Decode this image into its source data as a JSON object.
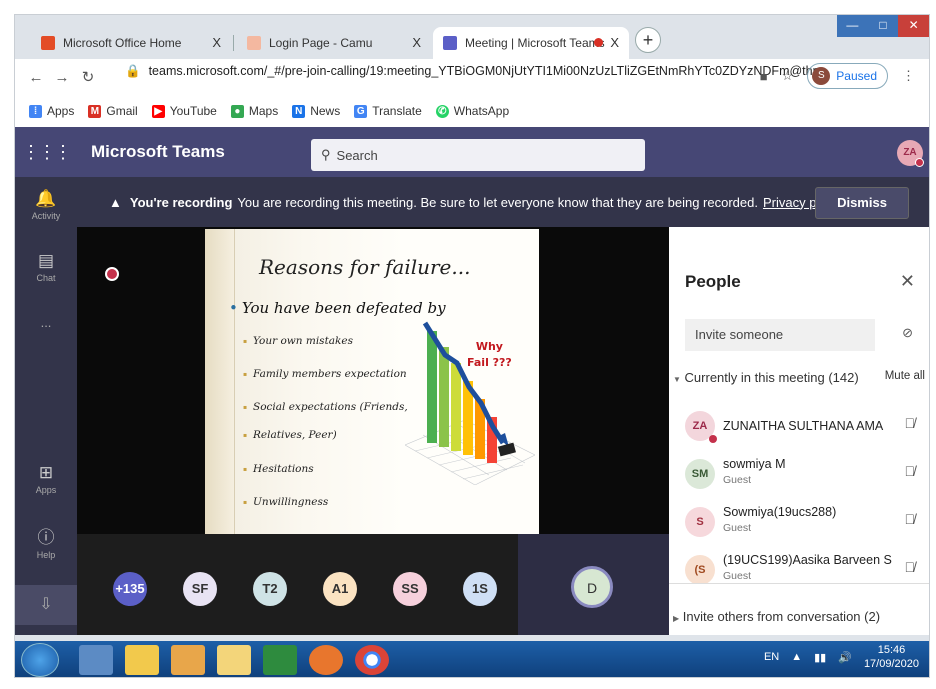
{
  "browser": {
    "tabs": [
      {
        "label": "Microsoft Office Home",
        "close": "X"
      },
      {
        "label": "Login Page - Camu",
        "close": "X"
      },
      {
        "label": "Meeting | Microsoft Teams",
        "close": "X"
      }
    ],
    "new_tab": "+",
    "url": "teams.microsoft.com/_#/pre-join-calling/19:meeting_YTBiOGM0NjUtYTI1Mi00NzUzLTliZGEtNmRhYTc0ZDYzNDFm@thr...",
    "profile_initial": "S",
    "paused_label": "Paused",
    "bookmarks": [
      {
        "label": "Apps",
        "color": "#4285f4"
      },
      {
        "label": "Gmail",
        "color": "#d93025"
      },
      {
        "label": "YouTube",
        "color": "#ff0000"
      },
      {
        "label": "Maps",
        "color": "#34a853"
      },
      {
        "label": "News",
        "color": "#1a73e8"
      },
      {
        "label": "Translate",
        "color": "#4285f4"
      },
      {
        "label": "WhatsApp",
        "color": "#25d366"
      }
    ]
  },
  "teams": {
    "app_title": "Microsoft Teams",
    "search_placeholder": "Search",
    "user_initials": "ZA",
    "rail": [
      {
        "label": "Activity",
        "icon": "bell-icon"
      },
      {
        "label": "Chat",
        "icon": "chat-icon"
      },
      {
        "label": "...",
        "icon": "more-icon"
      },
      {
        "label": "Apps",
        "icon": "apps-icon"
      },
      {
        "label": "Help",
        "icon": "help-icon"
      }
    ],
    "recording_bar": {
      "bold": "You're recording",
      "text": "You are recording this meeting. Be sure to let everyone know that they are being recorded.",
      "link": "Privacy policy",
      "dismiss": "Dismiss"
    },
    "slide": {
      "title": "Reasons for failure...",
      "subtitle": "You have been defeated by",
      "bullets": [
        "Your own mistakes",
        "Family members expectation",
        "Social expectations (Friends,",
        "Relatives, Peer)",
        "Hesitations",
        "Unwillingness"
      ],
      "why_line1": "Why",
      "why_line2": "Fail ???"
    },
    "tiles": [
      {
        "label": "+135",
        "bg": "#5b5fc7",
        "fg": "#ffffff"
      },
      {
        "label": "SF",
        "bg": "#e8e3f3",
        "fg": "#333333"
      },
      {
        "label": "T2",
        "bg": "#cfe3e6",
        "fg": "#333333"
      },
      {
        "label": "A1",
        "bg": "#fbe3c2",
        "fg": "#333333"
      },
      {
        "label": "SS",
        "bg": "#f6d0dc",
        "fg": "#333333"
      },
      {
        "label": "1S",
        "bg": "#cfdff5",
        "fg": "#333333"
      }
    ],
    "active_speaker": "D",
    "people": {
      "title": "People",
      "close": "X",
      "invite_placeholder": "Invite someone",
      "current_label": "Currently in this meeting (142)",
      "mute_all": "Mute all",
      "participants": [
        {
          "initials": "ZA",
          "name": "ZUNAITHA SULTHANA AMA",
          "role": "",
          "bg": "#f3d6dc",
          "fg": "#9c2a4a"
        },
        {
          "initials": "SM",
          "name": "sowmiya M",
          "role": "Guest",
          "bg": "#dbe8d8",
          "fg": "#3a5a36"
        },
        {
          "initials": "S",
          "name": "Sowmiya(19ucs288)",
          "role": "Guest",
          "bg": "#f6d8dc",
          "fg": "#a03040"
        },
        {
          "initials": "(S",
          "name": "(19UCS199)Aasika Barveen S",
          "role": "Guest",
          "bg": "#f8e0d0",
          "fg": "#a04a20"
        }
      ],
      "others": "Invite others from conversation (2)"
    }
  },
  "taskbar": {
    "lang": "EN",
    "time": "15:46",
    "date": "17/09/2020"
  }
}
